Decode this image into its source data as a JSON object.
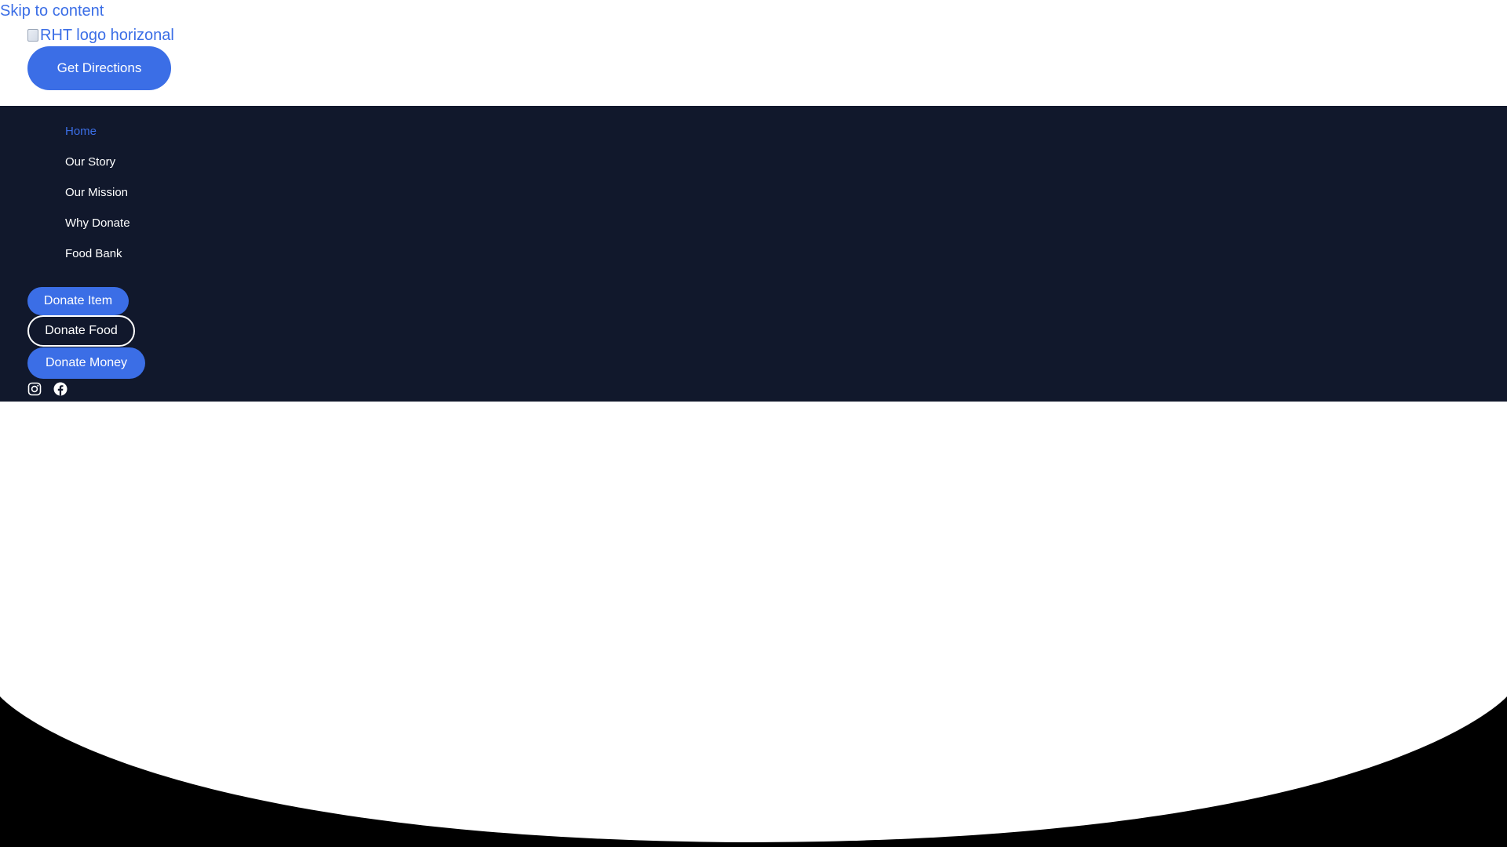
{
  "skip_link": {
    "label": "Skip to content"
  },
  "header": {
    "logo_alt": "RHT logo horizonal",
    "get_directions_label": "Get Directions"
  },
  "nav": {
    "items": [
      {
        "label": "Home",
        "active": true
      },
      {
        "label": "Our Story",
        "active": false
      },
      {
        "label": "Our Mission",
        "active": false
      },
      {
        "label": "Why Donate",
        "active": false
      },
      {
        "label": "Food Bank",
        "active": false
      }
    ]
  },
  "donate": {
    "item_label": "Donate Item",
    "food_label": "Donate Food",
    "money_label": "Donate Money"
  },
  "social": {
    "icons": [
      "instagram-icon",
      "facebook-icon"
    ]
  },
  "colors": {
    "accent": "#3b6ee6",
    "nav_bg": "#11182c",
    "page_bg": "#000000",
    "white": "#ffffff"
  }
}
